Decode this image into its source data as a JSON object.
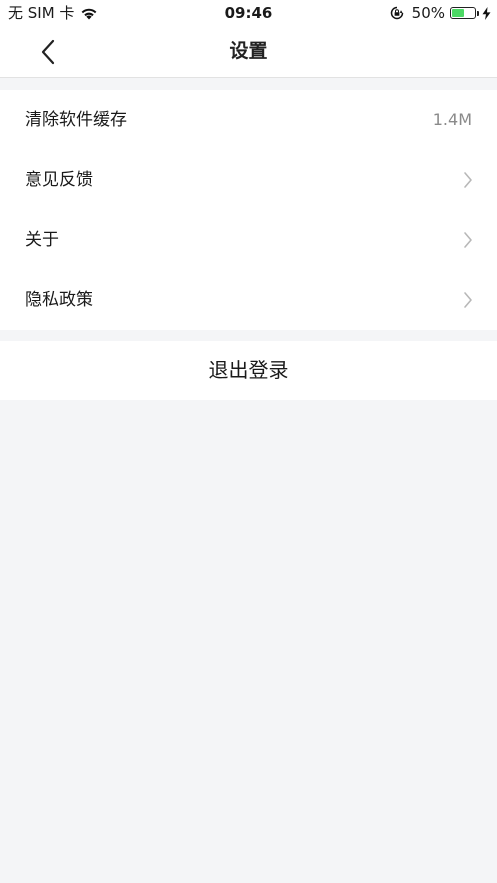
{
  "status_bar": {
    "carrier": "无 SIM 卡",
    "time": "09:46",
    "battery": "50%",
    "battery_level": 0.5,
    "icons": [
      "wifi-icon",
      "orientation-lock-icon",
      "battery-icon",
      "charging-bolt-icon"
    ]
  },
  "nav": {
    "title": "设置",
    "back_icon": "chevron-left-icon"
  },
  "menu": {
    "items": [
      {
        "label": "清除软件缓存",
        "value": "1.4M"
      },
      {
        "label": "意见反馈"
      },
      {
        "label": "关于"
      },
      {
        "label": "隐私政策"
      }
    ]
  },
  "logout": {
    "label": "退出登录"
  },
  "colors": {
    "background": "#f4f5f7",
    "surface": "#ffffff",
    "text": "#1a1a1a",
    "muted": "#8a8a8a",
    "battery_green": "#4cd964"
  }
}
